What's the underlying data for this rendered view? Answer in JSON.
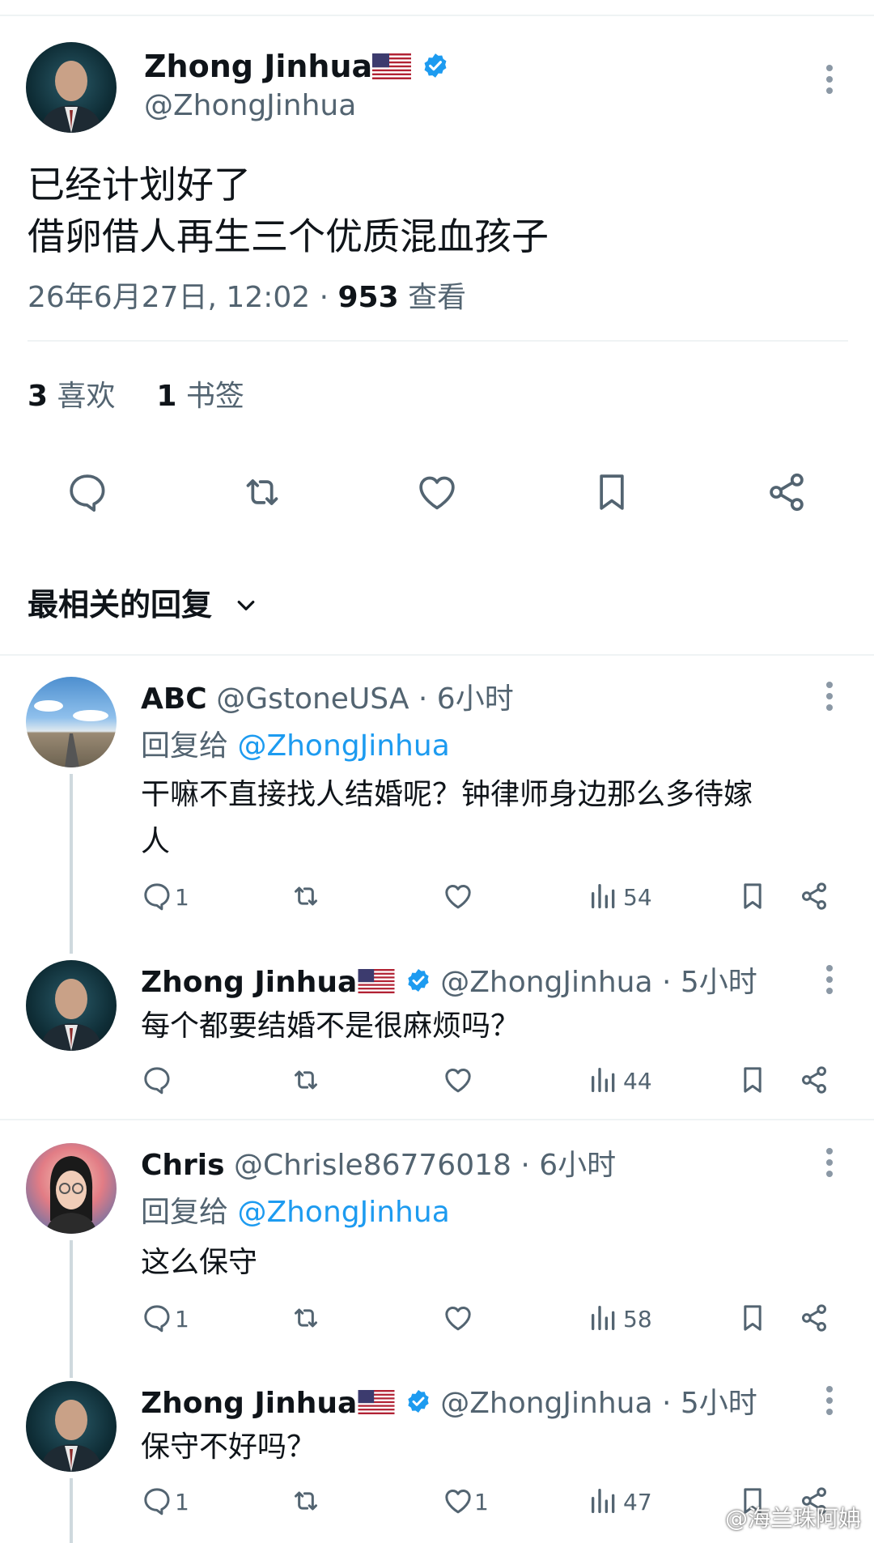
{
  "main_tweet": {
    "display_name": "Zhong Jinhua",
    "handle": "@ZhongJinhua",
    "text_line1": "已经计划好了",
    "text_line2": "借卵借人再生三个优质混血孩子",
    "timestamp": "26年6月27日, 12:02 · ",
    "views": "953",
    "views_label": " 查看",
    "likes_count": "3",
    "likes_label": " 喜欢",
    "bookmarks_count": "1",
    "bookmarks_label": " 书签"
  },
  "replies_sort": {
    "label": "最相关的回复"
  },
  "replies": [
    {
      "display_name": "ABC",
      "handle": "@GstoneUSA",
      "time": " · 6小时",
      "reply_to_prefix": "回复给 ",
      "reply_to_handle": "@ZhongJinhua",
      "text_line1": "干嘛不直接找人结婚呢？钟律师身边那么多待嫁",
      "text_line2": "人",
      "reply_count": "1",
      "like_count": "",
      "views": "54"
    },
    {
      "display_name": "Zhong Jinhua",
      "handle": "@ZhongJinhua",
      "time": " · 5小时",
      "text_line1": "每个都要结婚不是很麻烦吗？",
      "reply_count": "",
      "like_count": "",
      "views": "44"
    },
    {
      "display_name": "Chris",
      "handle": "@Chrisle86776018",
      "time": " · 6小时",
      "reply_to_prefix": "回复给 ",
      "reply_to_handle": "@ZhongJinhua",
      "text_line1": "这么保守",
      "reply_count": "1",
      "like_count": "",
      "views": "58"
    },
    {
      "display_name": "Zhong Jinhua",
      "handle": "@ZhongJinhua",
      "time": " · 5小时",
      "text_line1": "保守不好吗？",
      "reply_count": "1",
      "like_count": "1",
      "views": "47"
    }
  ],
  "watermark": "@海兰珠阿姌",
  "colors": {
    "accent": "#1d9bf0",
    "secondary_text": "#536471",
    "divider": "#eff3f4"
  },
  "icons": [
    "more-icon",
    "verified-icon",
    "us-flag-icon",
    "reply-icon",
    "retweet-icon",
    "like-icon",
    "bookmark-icon",
    "share-icon",
    "views-icon",
    "chevron-down-icon"
  ]
}
